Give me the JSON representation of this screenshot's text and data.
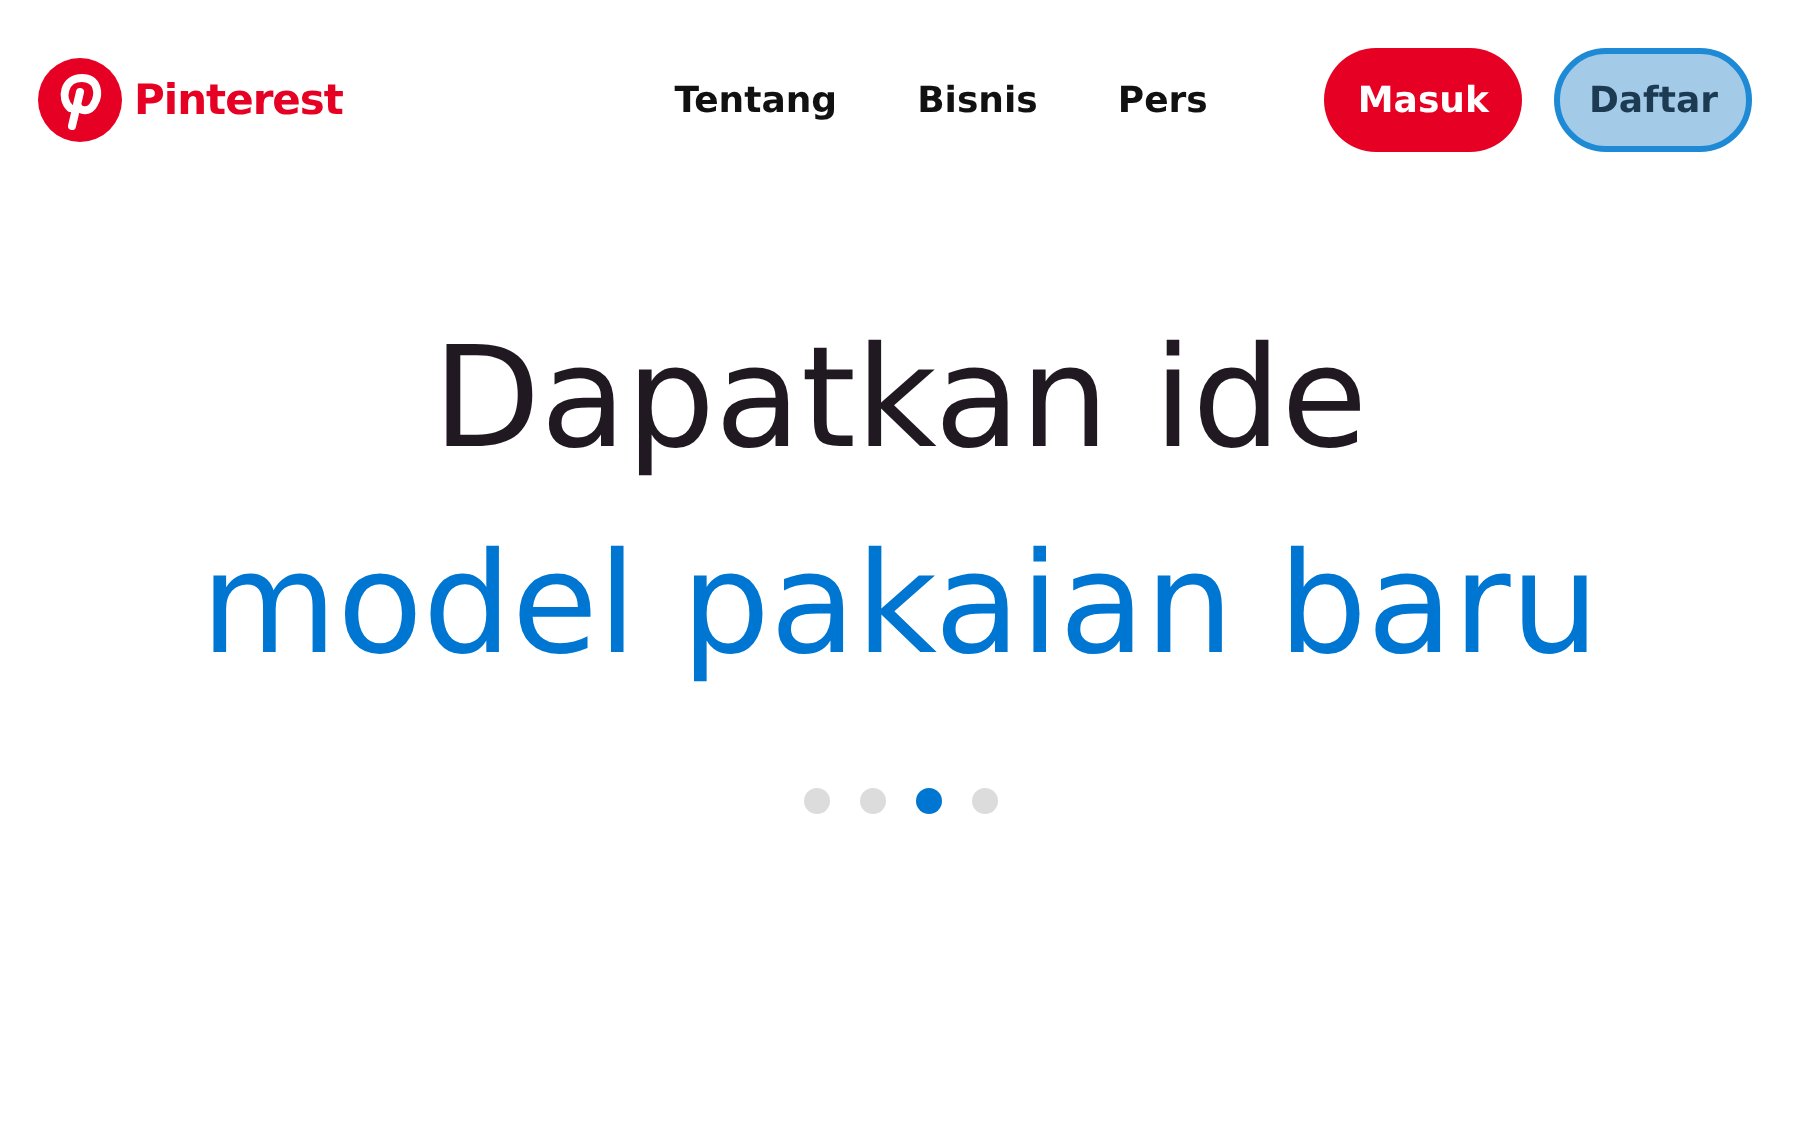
{
  "brand": {
    "name": "Pinterest"
  },
  "nav": [
    "Tentang",
    "Bisnis",
    "Pers"
  ],
  "buttons": [
    {
      "label": "Masuk",
      "kind": "primary",
      "focused": false
    },
    {
      "label": "Daftar",
      "kind": "secondary",
      "focused": true
    }
  ],
  "hero": {
    "title": "Dapatkan ide",
    "subtitle": "model pakaian baru"
  },
  "carousel_dots": [
    {
      "selected": false
    },
    {
      "selected": false
    },
    {
      "selected": true
    },
    {
      "selected": false
    }
  ]
}
